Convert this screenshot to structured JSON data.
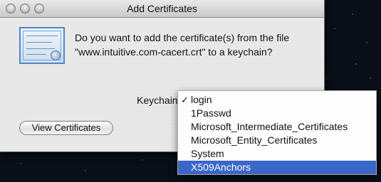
{
  "window": {
    "title": "Add Certificates"
  },
  "dialog": {
    "question_line1": "Do you want to add the certificate(s) from the file",
    "question_line2": "\"www.intuitive.com-cacert.crt\" to a keychain?",
    "keychain_label": "Keychain",
    "view_certificates_label": "View Certificates"
  },
  "keychain_menu": {
    "checkmark": "✓",
    "selected_value": "login",
    "highlighted_item": "X509Anchors",
    "items": [
      "login",
      "1Passwd",
      "Microsoft_Intermediate_Certificates",
      "Microsoft_Entity_Certificates",
      "System",
      "X509Anchors"
    ]
  },
  "icons": {
    "certificate": "certificate-icon"
  },
  "colors": {
    "menu_highlight": "#3a66c8",
    "window_background": "#e8e8e8"
  }
}
